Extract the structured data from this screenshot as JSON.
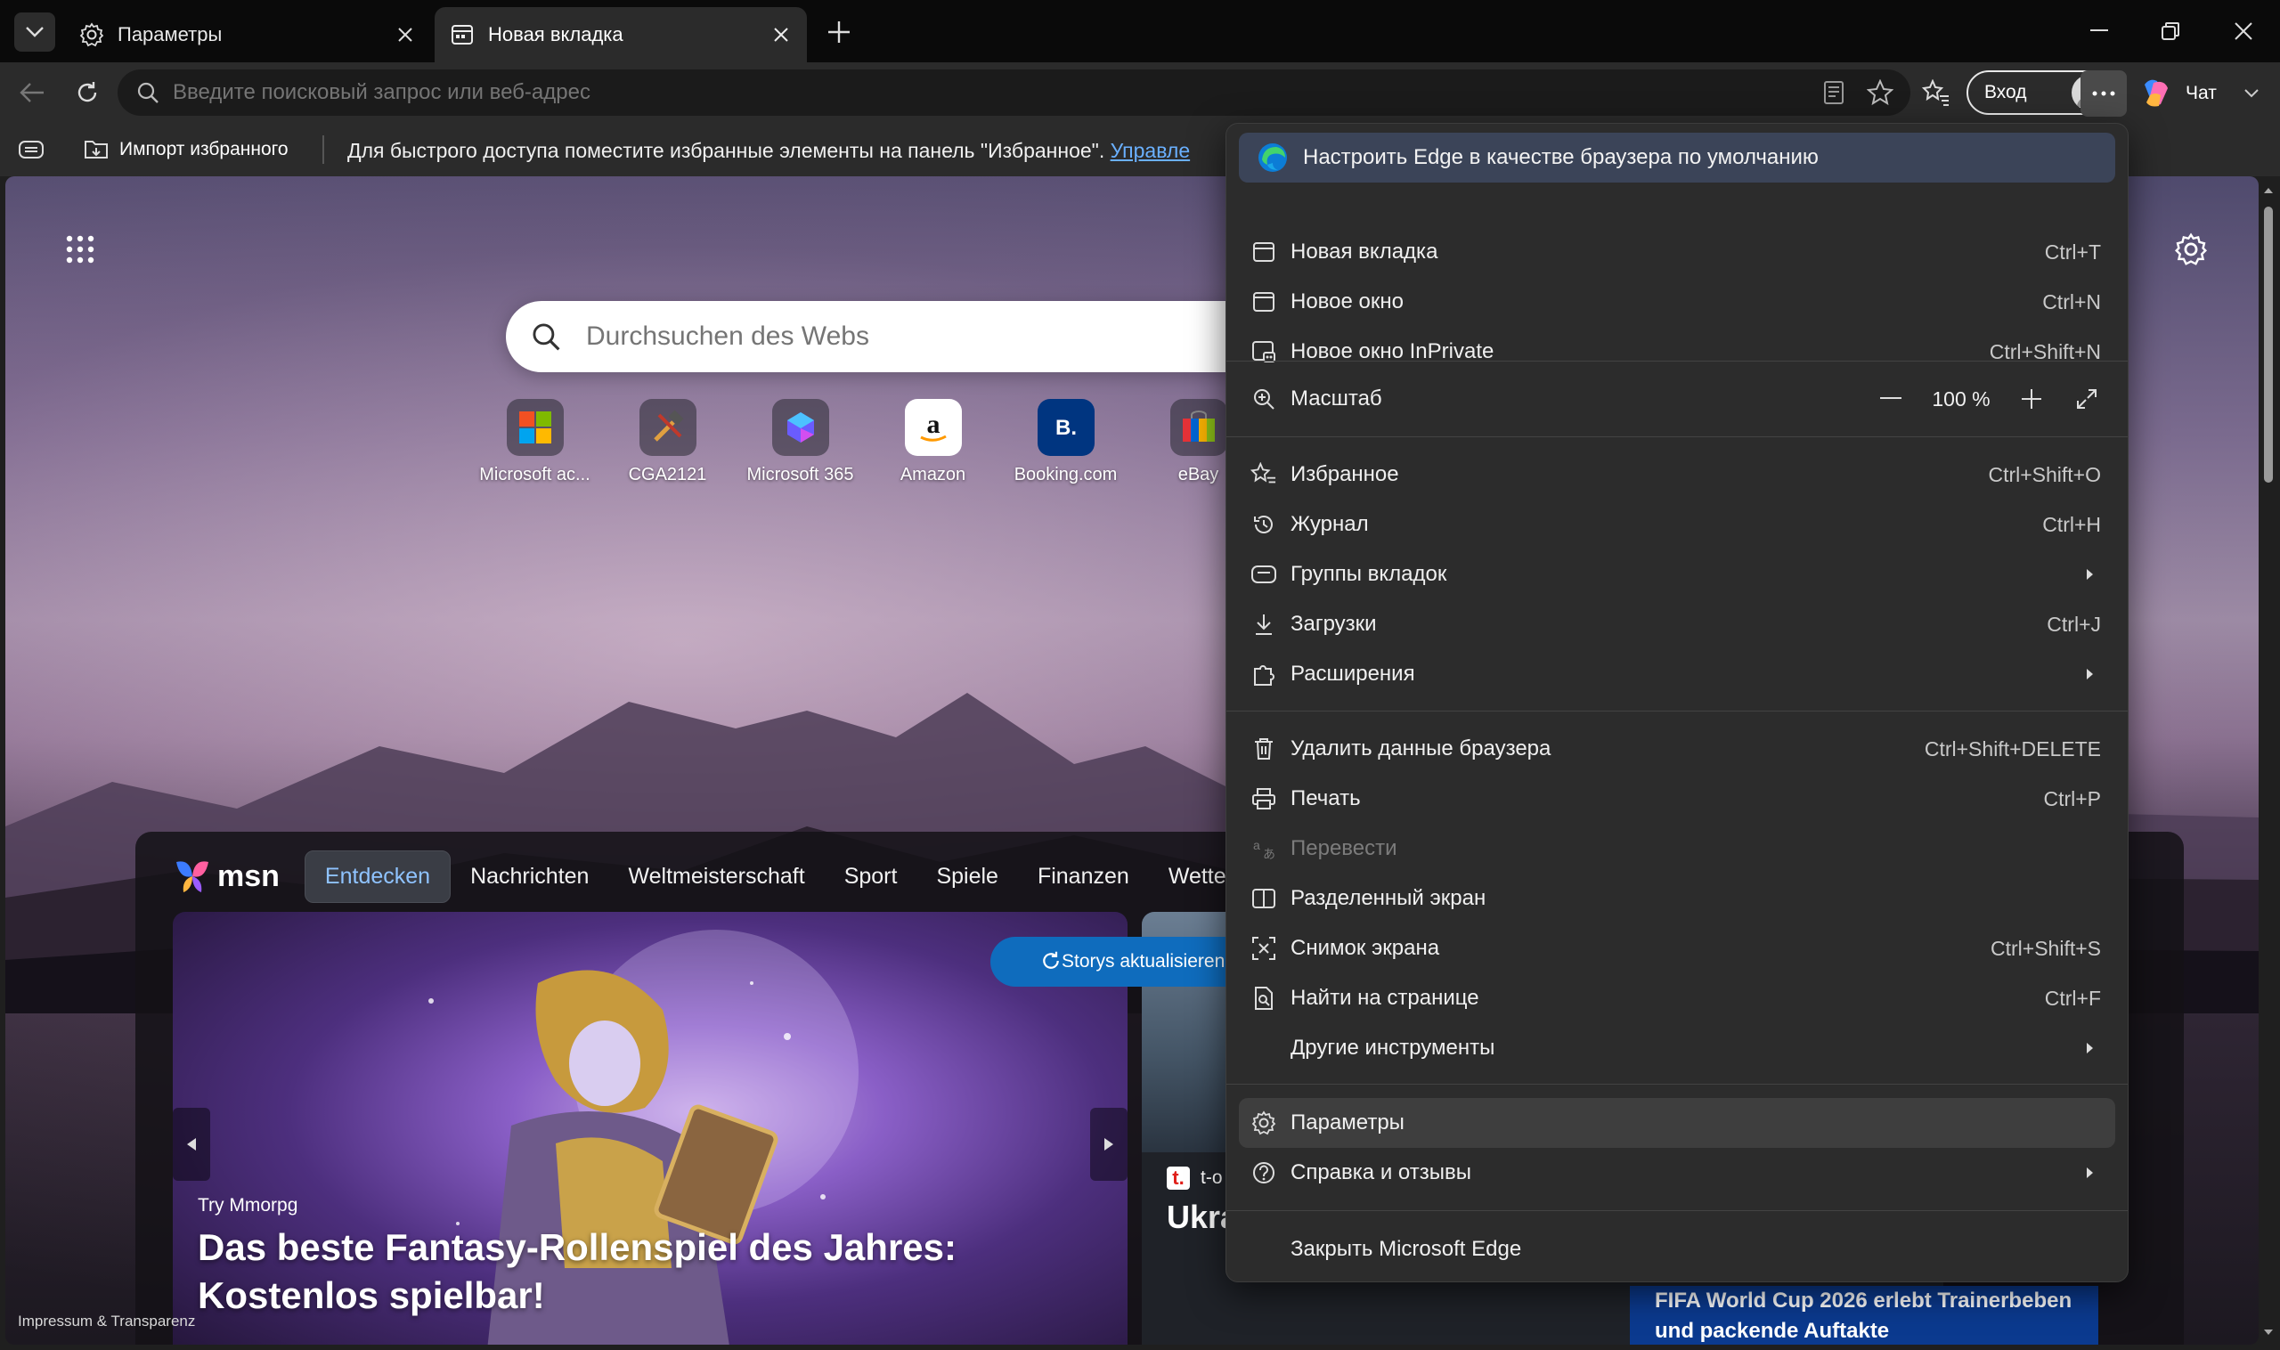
{
  "tabs": [
    {
      "title": "Параметры",
      "icon": "gear-icon"
    },
    {
      "title": "Новая вкладка",
      "icon": "newtab-page-icon"
    }
  ],
  "toolbar": {
    "address_placeholder": "Введите поисковый запрос или веб-адрес",
    "signin_label": "Вход",
    "copilot_label": "Чат"
  },
  "favbar": {
    "import_label": "Импорт избранного",
    "message": "Для быстрого доступа поместите избранные элементы на панель \"Избранное\".",
    "manage_link": "Управле"
  },
  "page": {
    "search_placeholder": "Durchsuchen des Webs",
    "quicklinks": [
      {
        "label": "Microsoft ac...",
        "icon": "microsoft-logo-icon"
      },
      {
        "label": "CGA2121",
        "icon": "tools-icon"
      },
      {
        "label": "Microsoft 365",
        "icon": "m365-logo-icon"
      },
      {
        "label": "Amazon",
        "icon": "amazon-logo-icon"
      },
      {
        "label": "Booking.com",
        "icon": "booking-logo-icon"
      },
      {
        "label": "eBay",
        "icon": "ebay-bag-icon"
      }
    ],
    "msn": {
      "logo_text": "msn",
      "tabs": [
        "Entdecken",
        "Nachrichten",
        "Weltmeisterschaft",
        "Sport",
        "Spiele",
        "Finanzen",
        "Wetter"
      ],
      "active_tab": "Entdecken",
      "hero": {
        "eyebrow": "Try Mmorpg",
        "title": "Das beste Fantasy-Rollenspiel des Jahres: Kostenlos spielbar!"
      },
      "card2": {
        "source": "t-o",
        "title": "Ukra"
      },
      "refresh_label": "Storys aktualisieren",
      "fifa_text": "FIFA World Cup 2026 erlebt Trainerbeben und packende Auftakte"
    },
    "impressum": "Impressum & Transparenz"
  },
  "menu": {
    "default_browser": "Настроить Edge в качестве браузера по умолчанию",
    "items": [
      {
        "label": "Новая вкладка",
        "shortcut": "Ctrl+T",
        "icon": "new-tab-icon"
      },
      {
        "label": "Новое окно",
        "shortcut": "Ctrl+N",
        "icon": "new-window-icon"
      },
      {
        "label": "Новое окно InPrivate",
        "shortcut": "Ctrl+Shift+N",
        "icon": "inprivate-icon"
      },
      {
        "label": "Масштаб",
        "zoom": "100 %",
        "icon": "zoom-icon"
      },
      {
        "label": "Избранное",
        "shortcut": "Ctrl+Shift+O",
        "icon": "favorites-icon"
      },
      {
        "label": "Журнал",
        "shortcut": "Ctrl+H",
        "icon": "history-icon"
      },
      {
        "label": "Группы вкладок",
        "submenu": true,
        "icon": "tab-groups-icon"
      },
      {
        "label": "Загрузки",
        "shortcut": "Ctrl+J",
        "icon": "download-icon"
      },
      {
        "label": "Расширения",
        "submenu": true,
        "icon": "extensions-icon"
      },
      {
        "label": "Удалить данные браузера",
        "shortcut": "Ctrl+Shift+DELETE",
        "icon": "trash-icon"
      },
      {
        "label": "Печать",
        "shortcut": "Ctrl+P",
        "icon": "print-icon"
      },
      {
        "label": "Перевести",
        "disabled": true,
        "icon": "translate-icon"
      },
      {
        "label": "Разделенный экран",
        "icon": "split-screen-icon"
      },
      {
        "label": "Снимок экрана",
        "shortcut": "Ctrl+Shift+S",
        "icon": "screenshot-icon"
      },
      {
        "label": "Найти на странице",
        "shortcut": "Ctrl+F",
        "icon": "find-icon"
      },
      {
        "label": "Другие инструменты",
        "submenu": true,
        "icon": ""
      },
      {
        "label": "Параметры",
        "icon": "settings-icon",
        "highlighted": true
      },
      {
        "label": "Справка и отзывы",
        "submenu": true,
        "icon": "help-icon"
      },
      {
        "label": "Закрыть Microsoft Edge",
        "icon": ""
      }
    ]
  }
}
